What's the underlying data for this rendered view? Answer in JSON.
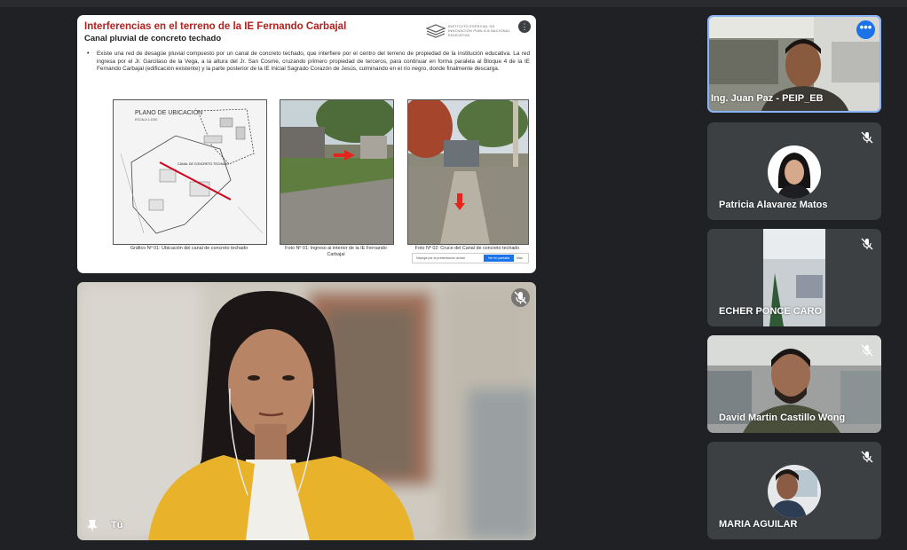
{
  "presentation": {
    "title": "Interferencias en el terreno de la IE Fernando Carbajal",
    "subtitle": "Canal pluvial de concreto techado",
    "logo_text": "INSTITUTO ESPECIAL DE INNOVACIÓN PÚBLICA NACIONAL EDUCATIVA",
    "bullet": "•",
    "body": "Existe una red de desagüe pluvial compuesto por un canal de concreto techado, que interfiere por el centro del terreno de propiedad de la institución educativa. La red ingresa por el Jr. Garcilaso de la Vega, a la altura del Jr. San Cosme, cruzando primero propiedad de terceros, para continuar en forma paralela al Bloque 4 de la IE Fernando Carbajal (edificación existente) y la parte posterior de la IE Inicial Sagrado Corazón de Jesús, culminando en el río negro, donde finalmente descarga.",
    "map_title": "PLANO DE UBICACIÓN",
    "map_scale": "ESCALA 1:1000",
    "map_label_canal": "CANAL DE CONCRETO TECHADO",
    "caption_1": "Gráfico Nº 01: Ubicación del canal de concreto techado",
    "caption_2": "Foto Nº 01: Ingreso al interior de la IE Fernando Carbajal",
    "caption_3": "Foto Nº 02: Cruce del Canal de concreto techado",
    "popup_text": "Navega por la presentación actual",
    "popup_button": "Ver en pantalla",
    "popup_more": "Más"
  },
  "self_tile": {
    "name": "Tú"
  },
  "participants": [
    {
      "name": "Ing. Juan Paz - PEIP_EB",
      "muted": false,
      "speaking": true,
      "more_label": "•••"
    },
    {
      "name": "Patricia Alavarez Matos",
      "muted": true
    },
    {
      "name": "ECHER PONCE CARO",
      "muted": true
    },
    {
      "name": "David Martin Castillo Wong",
      "muted": true
    },
    {
      "name": "MARIA AGUILAR",
      "muted": true
    }
  ]
}
